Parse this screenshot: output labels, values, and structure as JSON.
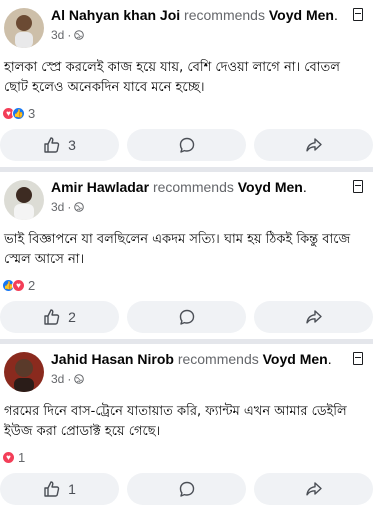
{
  "posts": [
    {
      "author": "Al Nahyan khan Joi",
      "recommends": "recommends",
      "page": "Voyd Men",
      "time": "3d",
      "text": "হালকা স্প্রে করলেই কাজ হয়ে যায়, বেশি দেওয়া লাগে না। বোতল ছোট হলেও অনেকদিন যাবে মনে হচ্ছে।",
      "reaction_count": "3",
      "like_count": "3",
      "reaction_icons": [
        "heart-icon",
        "like-icon"
      ]
    },
    {
      "author": "Amir Hawladar",
      "recommends": "recommends",
      "page": "Voyd Men",
      "time": "3d",
      "text": "ভাই বিজ্ঞাপনে যা বলছিলেন একদম সত্যি। ঘাম হয় ঠিকই কিন্তু বাজে স্মেল আসে না।",
      "reaction_count": "2",
      "like_count": "2",
      "reaction_icons": [
        "like-icon",
        "heart-icon"
      ]
    },
    {
      "author": "Jahid Hasan Nirob",
      "recommends": "recommends",
      "page": "Voyd Men",
      "time": "3d",
      "text": "গরমের দিনে বাস-ট্রেনে যাতায়াত করি, ফ্যান্টম এখন আমার ডেইলি ইউজ করা প্রোডাক্ট হয়ে গেছে।",
      "reaction_count": "1",
      "like_count": "1",
      "reaction_icons": [
        "heart-icon"
      ]
    }
  ],
  "colors": {
    "like_blue": "#1877f2",
    "heart_red": "#f33e58",
    "action_bg": "#f0f2f5",
    "divider": "#e4e6eb"
  }
}
